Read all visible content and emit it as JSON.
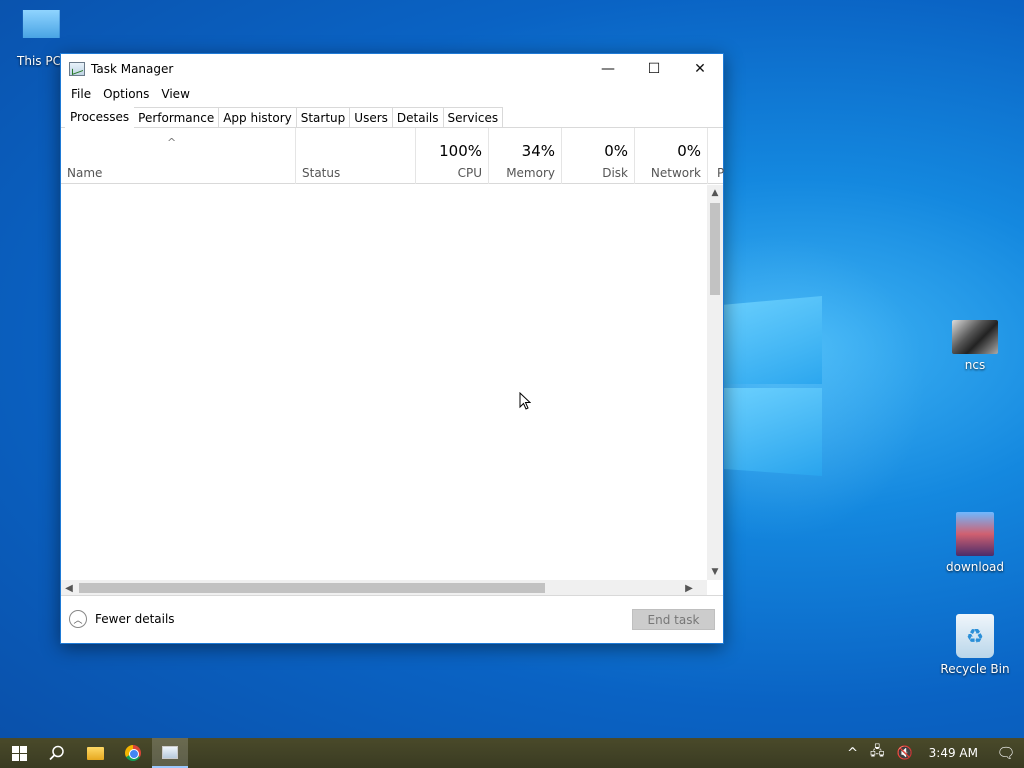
{
  "desktop": {
    "icons": [
      {
        "label": "This PC"
      },
      {
        "label": "ncs"
      },
      {
        "label": "download"
      },
      {
        "label": "Recycle Bin"
      }
    ]
  },
  "window": {
    "title": "Task Manager",
    "controls": {
      "minimize": "—",
      "maximize": "☐",
      "close": "✕"
    }
  },
  "menu": [
    "File",
    "Options",
    "View"
  ],
  "tabs": [
    "Processes",
    "Performance",
    "App history",
    "Startup",
    "Users",
    "Details",
    "Services"
  ],
  "active_tab": "Processes",
  "columns": {
    "name": {
      "label": "Name"
    },
    "status": {
      "label": "Status"
    },
    "cpu": {
      "pct": "100%",
      "label": "CPU"
    },
    "memory": {
      "pct": "34%",
      "label": "Memory"
    },
    "disk": {
      "pct": "0%",
      "label": "Disk"
    },
    "network": {
      "pct": "0%",
      "label": "Network"
    },
    "power": {
      "label": "P"
    }
  },
  "footer": {
    "fewer_details": "Fewer details",
    "end_task": "End task"
  },
  "taskbar": {
    "clock": "3:49 AM"
  }
}
